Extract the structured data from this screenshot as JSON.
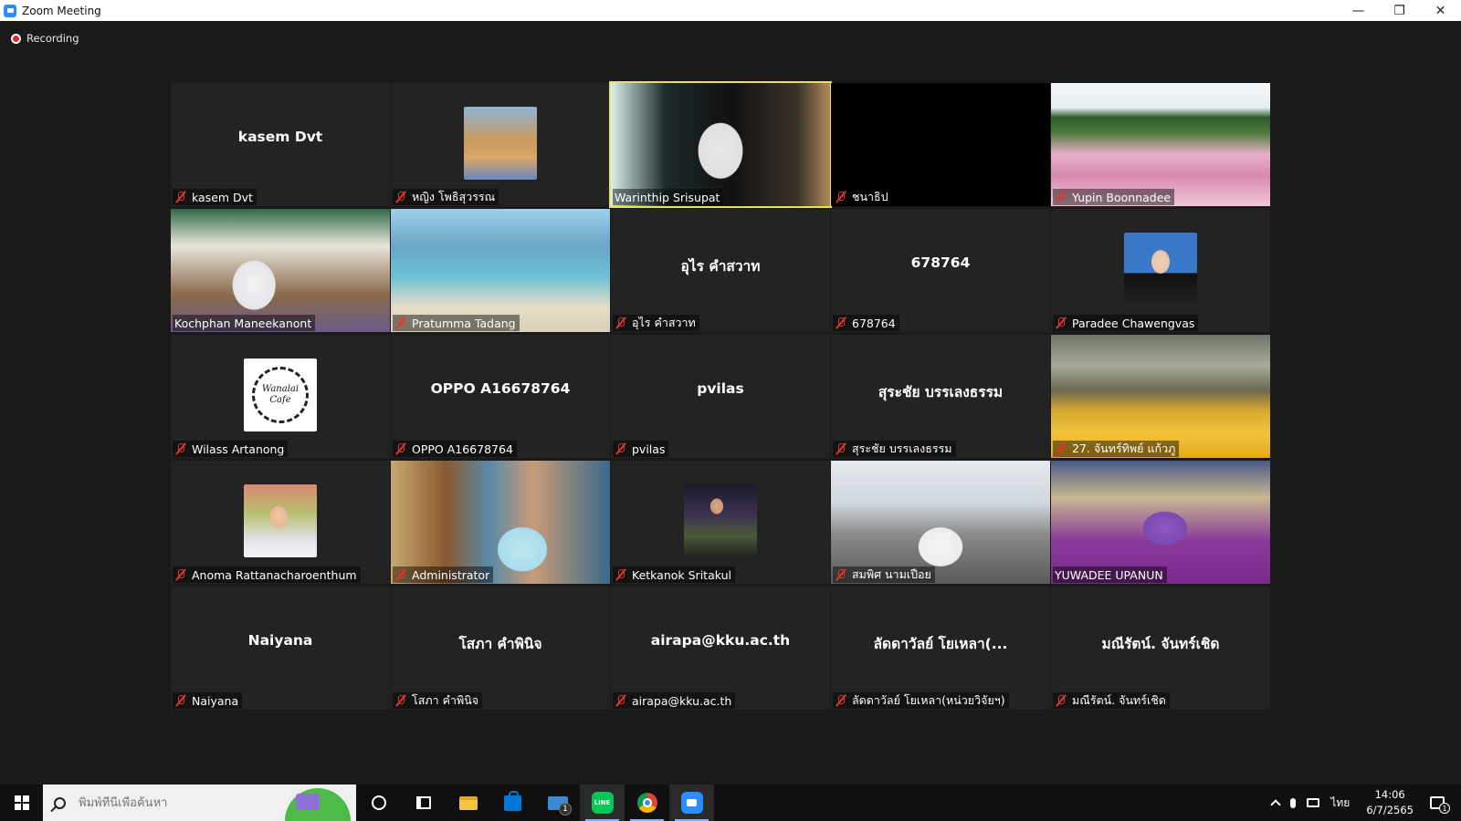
{
  "window": {
    "title": "Zoom Meeting",
    "minimize": "—",
    "restore": "❐",
    "close": "✕"
  },
  "recording": {
    "label": "Recording"
  },
  "participants": [
    {
      "display": "kasem Dvt",
      "label": "kasem Dvt",
      "kind": "name"
    },
    {
      "label": "หญิง โพธิสุวรรณ",
      "kind": "photo"
    },
    {
      "label": "Warinthip Srisupat",
      "kind": "video",
      "speaking": true
    },
    {
      "label": "ชนาธิป",
      "kind": "black"
    },
    {
      "label": "Yupin Boonnadee",
      "kind": "video"
    },
    {
      "label": "Kochphan Maneekanont",
      "kind": "video"
    },
    {
      "label": "Pratumma Tadang",
      "kind": "video"
    },
    {
      "display": "อุไร  คำสวาท",
      "label": "อุไร  คำสวาท",
      "kind": "name"
    },
    {
      "display": "678764",
      "label": "678764",
      "kind": "name"
    },
    {
      "label": "Paradee Chawengvas",
      "kind": "photo"
    },
    {
      "label": "Wilass Artanong",
      "kind": "logo",
      "logo_text": "Wanalai Cafe"
    },
    {
      "display": "OPPO A16678764",
      "label": "OPPO A16678764",
      "kind": "name"
    },
    {
      "display": "pvilas",
      "label": "pvilas",
      "kind": "name"
    },
    {
      "display": "สุระชัย บรรเลงธรรม",
      "label": "สุระชัย บรรเลงธรรม",
      "kind": "name"
    },
    {
      "label": "27. จันทร์ทิพย์ แก้วภู",
      "kind": "video"
    },
    {
      "label": "Anoma Rattanacharoenthum",
      "kind": "photo"
    },
    {
      "label": "Administrator",
      "kind": "video"
    },
    {
      "label": "Ketkanok Sritakul",
      "kind": "photo"
    },
    {
      "label": "สมพิศ นามเปือย",
      "kind": "video"
    },
    {
      "label": "YUWADEE UPANUN",
      "kind": "video"
    },
    {
      "display": "Naiyana",
      "label": "Naiyana",
      "kind": "name"
    },
    {
      "display": "โสภา คำพินิจ",
      "label": "โสภา คำพินิจ",
      "kind": "name"
    },
    {
      "display": "airapa@kku.ac.th",
      "label": "airapa@kku.ac.th",
      "kind": "name"
    },
    {
      "display": "ลัดดาวัลย์ โยเหลา(...",
      "label": "ลัดดาวัลย์ โยเหลา(หน่วยวิจัยฯ)",
      "kind": "name"
    },
    {
      "display": "มณีรัตน์. จันทร์เชิด",
      "label": "มณีรัตน์. จันทร์เชิด",
      "kind": "name"
    }
  ],
  "taskbar": {
    "search_placeholder": "พิมพ์ที่นี่เพื่อค้นหา",
    "mail_badge": "1",
    "line_label": "LINE",
    "language": "ไทย",
    "time": "14:06",
    "date": "6/7/2565",
    "notification_count": "1"
  },
  "colors": {
    "speaking_border": "#e9e05b",
    "muted_icon": "#e0362c",
    "zoom_blue": "#2d8cff",
    "background": "#1a1a1a",
    "tile": "#232323"
  },
  "icons": [
    "zoom-icon",
    "recording-icon",
    "muted-mic-icon",
    "windows-start-icon",
    "search-icon",
    "cortana-icon",
    "task-view-icon",
    "file-explorer-icon",
    "store-icon",
    "mail-icon",
    "line-icon",
    "chrome-icon",
    "zoom-icon",
    "chevron-up-icon",
    "microphone-icon",
    "network-icon",
    "notification-icon"
  ]
}
